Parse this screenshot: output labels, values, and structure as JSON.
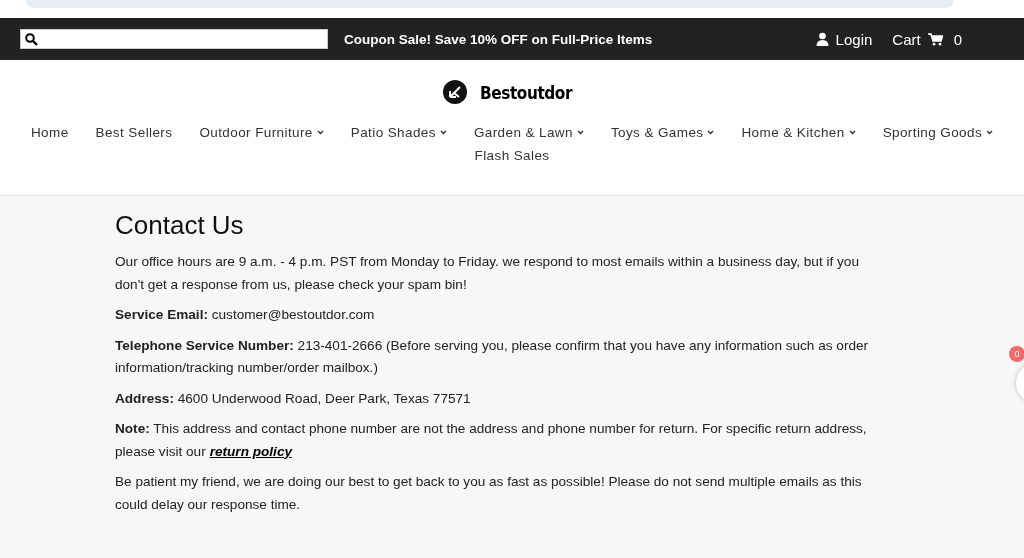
{
  "topbar": {
    "promo": "Coupon Sale! Save 10% OFF on Full-Price Items",
    "login": "Login",
    "cart": {
      "label": "Cart",
      "count": "0"
    }
  },
  "logo": {
    "text": "Bestoutdor"
  },
  "nav": [
    {
      "label": "Home",
      "dropdown": false
    },
    {
      "label": "Best Sellers",
      "dropdown": false
    },
    {
      "label": "Outdoor Furniture",
      "dropdown": true
    },
    {
      "label": "Patio Shades",
      "dropdown": true
    },
    {
      "label": "Garden & Lawn",
      "dropdown": true
    },
    {
      "label": "Toys & Games",
      "dropdown": true
    },
    {
      "label": "Home & Kitchen",
      "dropdown": true
    },
    {
      "label": "Sporting Goods",
      "dropdown": true
    },
    {
      "label": "Flash Sales",
      "dropdown": false
    }
  ],
  "page": {
    "title": "Contact Us",
    "paragraphs": [
      {
        "text": "Our office hours are 9 a.m. - 4 p.m. PST from Monday to Friday. we respond to most emails within a business day, but if you don't get a response from us, please check your spam bin!"
      },
      {
        "text": "**Service Email:** customer@bestoutdor.com"
      },
      {
        "text": "**Telephone Service Number:** 213-401-2666 (Before serving you, please confirm that you have any information such as order information/tracking number/order mailbox.)"
      },
      {
        "text": "**Address:** 4600 Underwood Road, Deer Park, Texas 77571"
      },
      {
        "text": "**Note:** This address and contact phone number are not the address and phone number for return. For specific return address, please visit our",
        "link": "return policy"
      },
      {
        "text": "Be patient my friend, we are doing our best to get back to you as fast as possible! Please do not send multiple emails as this could delay our response time."
      }
    ]
  },
  "floating_cart": {
    "count": "0"
  }
}
